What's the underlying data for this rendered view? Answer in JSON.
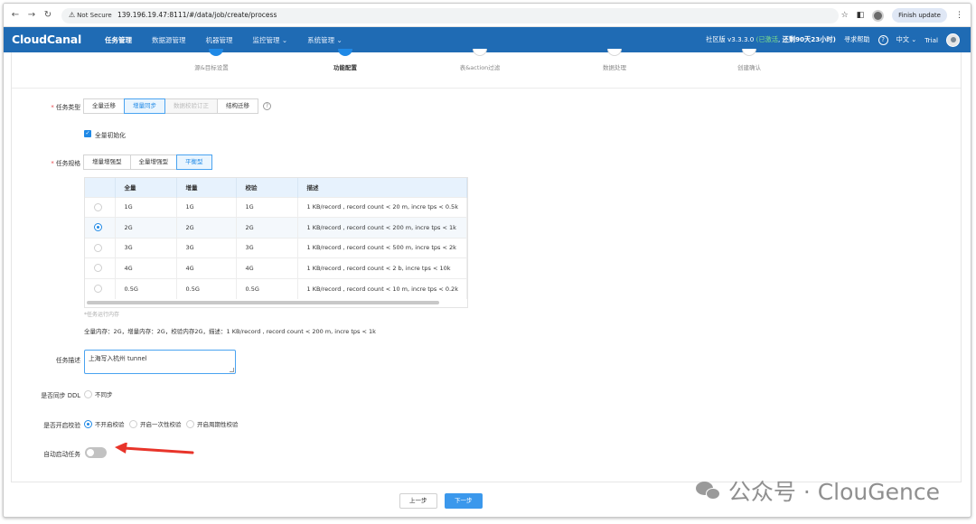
{
  "browser": {
    "security": "Not Secure",
    "url": "139.196.19.47:8111/#/data/job/create/process",
    "finish_update": "Finish update"
  },
  "app": {
    "logo": "CloudCanal",
    "nav": [
      "任务管理",
      "数据源管理",
      "机器管理",
      "监控管理 ⌄",
      "系统管理 ⌄"
    ],
    "edition": "社区版 v3.3.3.0",
    "activated": "(已激活",
    "remaining": "还剩90天23小时)",
    "help": "寻求帮助",
    "language": "中文 ⌄",
    "user": "Trial"
  },
  "steps": [
    {
      "label": "源&目标设置",
      "state": "done"
    },
    {
      "label": "功能配置",
      "state": "current"
    },
    {
      "label": "表&action过滤",
      "state": "todo"
    },
    {
      "label": "数据处理",
      "state": "todo"
    },
    {
      "label": "创建确认",
      "state": "todo"
    }
  ],
  "form": {
    "task_type_label": "任务类型",
    "task_types": [
      "全量迁移",
      "增量同步",
      "数据校验订正",
      "结构迁移"
    ],
    "task_type_selected": 1,
    "full_init_label": "全量初始化",
    "spec_label": "任务规格",
    "specs": [
      "增量增强型",
      "全量增强型",
      "平衡型"
    ],
    "spec_selected": 2,
    "table_headers": [
      "",
      "全量",
      "增量",
      "校验",
      "描述"
    ],
    "table_rows": [
      [
        "1G",
        "1G",
        "1G",
        "1 KB/record , record count < 20 m, incre tps < 0.5k"
      ],
      [
        "2G",
        "2G",
        "2G",
        "1 KB/record , record count < 200 m, incre tps < 1k"
      ],
      [
        "3G",
        "3G",
        "3G",
        "1 KB/record , record count < 500 m, incre tps < 2k"
      ],
      [
        "4G",
        "4G",
        "4G",
        "1 KB/record , record count < 2 b, incre tps < 10k"
      ],
      [
        "0.5G",
        "0.5G",
        "0.5G",
        "1 KB/record , record count < 10 m, incre tps < 0.2k"
      ]
    ],
    "table_selected_row": 1,
    "memory_hint": "*任务运行内存",
    "memory_summary": "全量内存：2G，增量内存：2G，校验内存2G，描述：1 KB/record , record count < 200 m, incre tps < 1k",
    "desc_label": "任务描述",
    "desc_value": "上海写入杭州 tunnel",
    "ddl_label": "是否同步 DDL",
    "ddl_option": "不同步",
    "verify_label": "是否开启校验",
    "verify_options": [
      "不开启校验",
      "开启一次性校验",
      "开启周期性校验"
    ],
    "auto_start_label": "自动启动任务"
  },
  "footer": {
    "prev": "上一步",
    "next": "下一步"
  },
  "watermark": "公众号 · ClouGence",
  "colors": {
    "brand": "#1f6bb4",
    "accent": "#1f89e6",
    "annotation_arrow": "#e8342a"
  }
}
